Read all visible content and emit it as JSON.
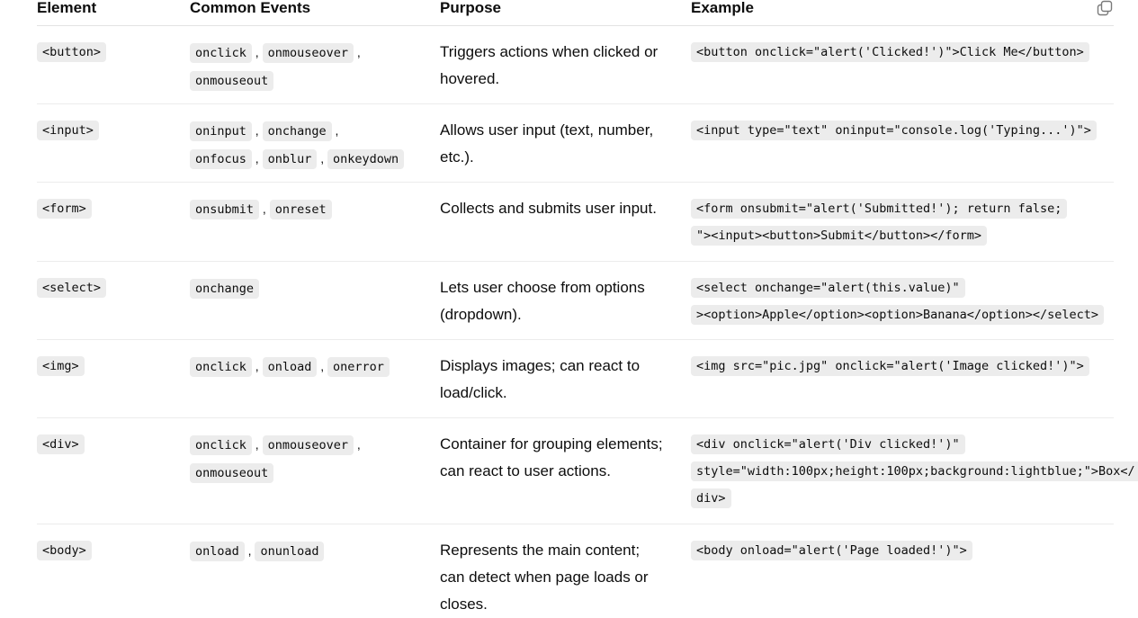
{
  "headers": {
    "element": "Element",
    "events": "Common Events",
    "purpose": "Purpose",
    "example": "Example"
  },
  "copy_icon": "copy-icon",
  "rows": [
    {
      "element": "<button>",
      "events": [
        "onclick",
        "onmouseover",
        "onmouseout"
      ],
      "purpose": "Triggers actions when clicked or hovered.",
      "example": "<button onclick=\"alert('Clicked!')\">Click Me</button>"
    },
    {
      "element": "<input>",
      "events": [
        "oninput",
        "onchange",
        "onfocus",
        "onblur",
        "onkeydown"
      ],
      "purpose": "Allows user input (text, number, etc.).",
      "example": "<input type=\"text\" oninput=\"console.log('Typing...')\">"
    },
    {
      "element": "<form>",
      "events": [
        "onsubmit",
        "onreset"
      ],
      "purpose": "Collects and submits user input.",
      "example": "<form onsubmit=\"alert('Submitted!'); return false;\"><input><button>Submit</button></form>"
    },
    {
      "element": "<select>",
      "events": [
        "onchange"
      ],
      "purpose": "Lets user choose from options (dropdown).",
      "example": "<select onchange=\"alert(this.value)\"><option>Apple</option><option>Banana</option></select>"
    },
    {
      "element": "<img>",
      "events": [
        "onclick",
        "onload",
        "onerror"
      ],
      "purpose": "Displays images; can react to load/click.",
      "example": "<img src=\"pic.jpg\" onclick=\"alert('Image clicked!')\">"
    },
    {
      "element": "<div>",
      "events": [
        "onclick",
        "onmouseover",
        "onmouseout"
      ],
      "purpose": "Container for grouping elements; can react to user actions.",
      "example": "<div onclick=\"alert('Div clicked!')\" style=\"width:100px;height:100px;background:lightblue;\">Box</div>"
    },
    {
      "element": "<body>",
      "events": [
        "onload",
        "onunload"
      ],
      "purpose": "Represents the main content; can detect when page loads or closes.",
      "example": "<body onload=\"alert('Page loaded!')\">"
    }
  ]
}
